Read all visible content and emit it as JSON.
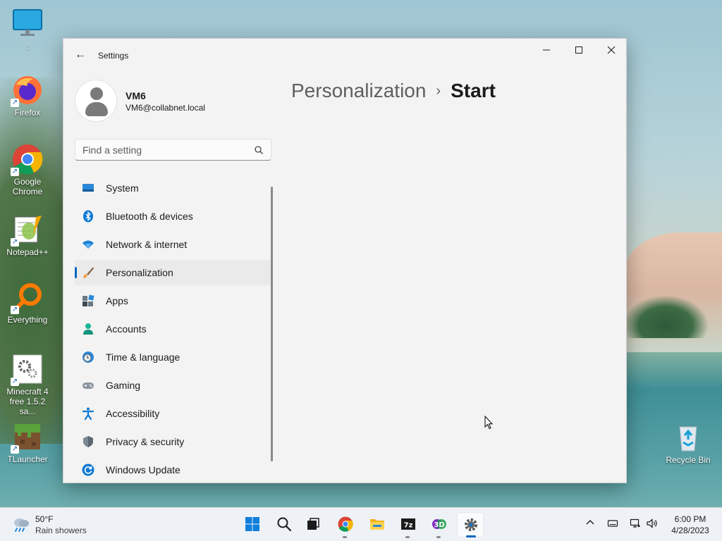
{
  "desktop": {
    "icons": [
      {
        "label": ":"
      },
      {
        "label": "Firefox"
      },
      {
        "label": "Google Chrome"
      },
      {
        "label": "Notepad++"
      },
      {
        "label": "Everything"
      },
      {
        "label": "Minecraft 4 free 1.5.2 sa..."
      },
      {
        "label": "TLauncher"
      }
    ],
    "recycle_bin": {
      "label": "Recycle Bin"
    }
  },
  "window": {
    "title": "Settings",
    "back_icon": "back-arrow-icon",
    "controls": {
      "minimize": "—",
      "maximize": "☐",
      "close": "✕"
    }
  },
  "profile": {
    "name": "VM6",
    "email": "VM6@collabnet.local"
  },
  "search": {
    "placeholder": "Find a setting",
    "value": ""
  },
  "nav": {
    "items": [
      {
        "label": "System",
        "icon": "system-icon",
        "selected": false
      },
      {
        "label": "Bluetooth & devices",
        "icon": "bluetooth-icon",
        "selected": false
      },
      {
        "label": "Network & internet",
        "icon": "wifi-icon",
        "selected": false
      },
      {
        "label": "Personalization",
        "icon": "brush-icon",
        "selected": true
      },
      {
        "label": "Apps",
        "icon": "apps-icon",
        "selected": false
      },
      {
        "label": "Accounts",
        "icon": "accounts-icon",
        "selected": false
      },
      {
        "label": "Time & language",
        "icon": "clock-globe-icon",
        "selected": false
      },
      {
        "label": "Gaming",
        "icon": "gamepad-icon",
        "selected": false
      },
      {
        "label": "Accessibility",
        "icon": "accessibility-icon",
        "selected": false
      },
      {
        "label": "Privacy & security",
        "icon": "shield-icon",
        "selected": false
      },
      {
        "label": "Windows Update",
        "icon": "update-icon",
        "selected": false
      }
    ]
  },
  "breadcrumb": {
    "parent": "Personalization",
    "separator": "›",
    "current": "Start"
  },
  "taskbar": {
    "weather": {
      "temp": "50°F",
      "desc": "Rain showers"
    },
    "apps": [
      {
        "name": "start-button"
      },
      {
        "name": "search-button"
      },
      {
        "name": "task-view-button"
      },
      {
        "name": "chrome-taskbar-button"
      },
      {
        "name": "file-explorer-taskbar-button"
      },
      {
        "name": "7zip-taskbar-button"
      },
      {
        "name": "3d-app-taskbar-button"
      },
      {
        "name": "settings-taskbar-button"
      }
    ],
    "clock": {
      "time": "6:00 PM",
      "date": "4/28/2023"
    }
  },
  "colors": {
    "accent": "#0067c0",
    "window_bg": "#f3f3f3",
    "taskbar_bg": "#eef2f6"
  }
}
